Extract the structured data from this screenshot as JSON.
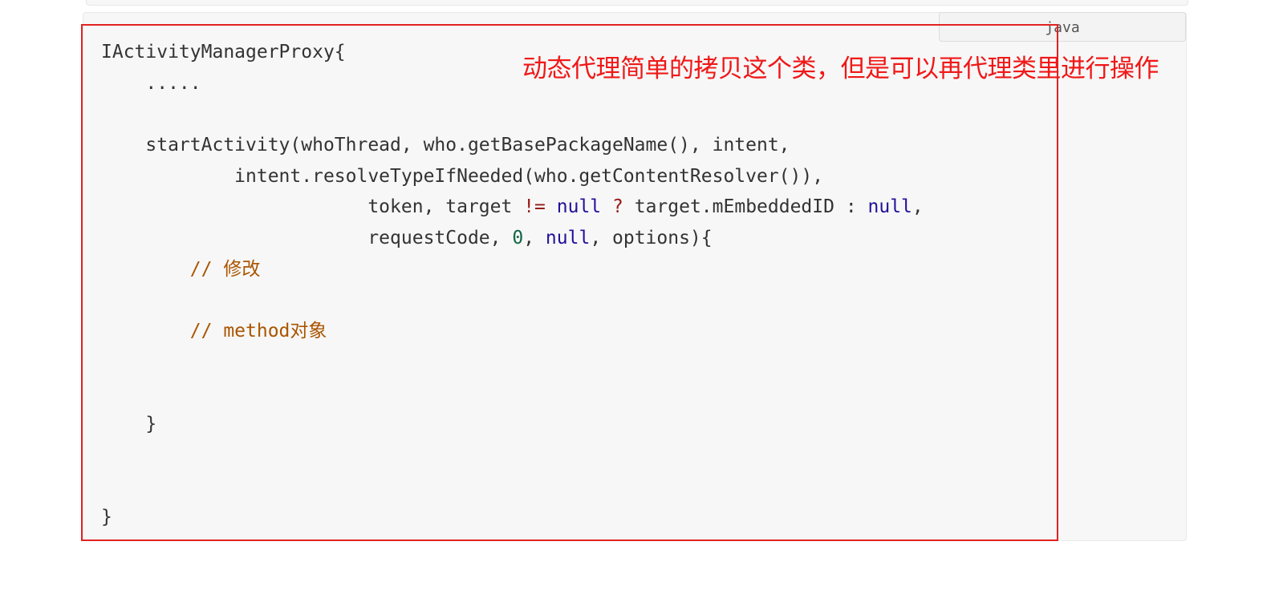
{
  "code_block": {
    "language": "java",
    "annotation": "动态代理简单的拷贝这个类，但是可以再代理类里进行操作",
    "highlight_color": "#e22222",
    "annotation_color": "#f01818",
    "lines": {
      "l1": "IActivityManagerProxy{",
      "l2": "    .....",
      "l4_a": "    startActivity(whoThread, who.getBasePackageName(), intent,",
      "l5": "            intent.resolveTypeIfNeeded(who.getContentResolver()),",
      "l6_a": "                        token, target ",
      "l6_op1": "!=",
      "l6_b": " ",
      "l6_null1": "null",
      "l6_c": " ",
      "l6_op2": "?",
      "l6_d": " target.mEmbeddedID : ",
      "l6_null2": "null",
      "l6_e": ",",
      "l7_a": "                        requestCode, ",
      "l7_num": "0",
      "l7_b": ", ",
      "l7_null": "null",
      "l7_c": ", options){",
      "l8_comment": "        // 修改",
      "l10_comment": "        // method对象",
      "l13": "    }",
      "l16": "}"
    }
  }
}
